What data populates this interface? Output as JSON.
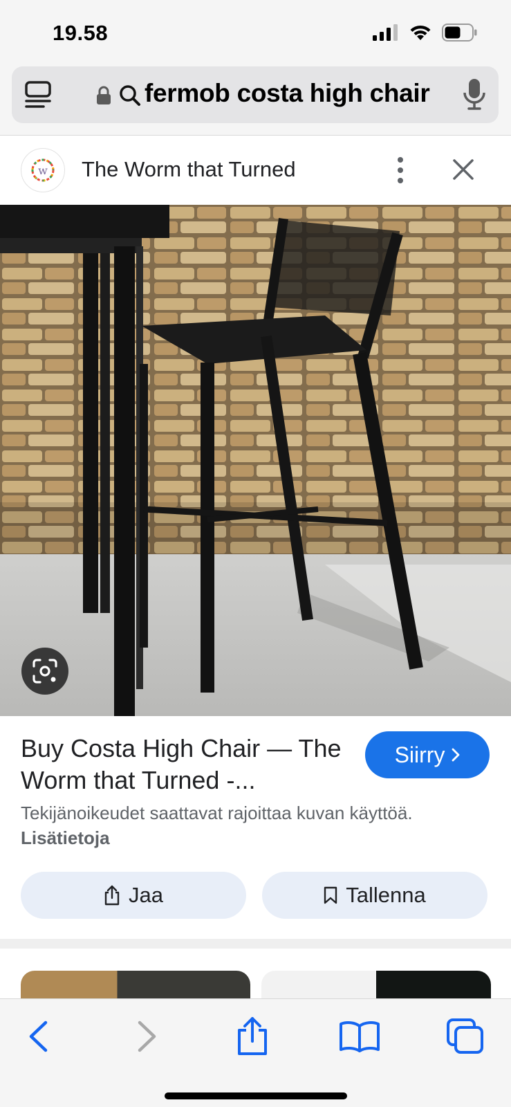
{
  "status": {
    "time": "19.58",
    "icons": [
      "signal-icon",
      "wifi-icon",
      "battery-icon"
    ]
  },
  "browser": {
    "tabs_icon": "tab-overview-icon",
    "lock_icon": "lock-icon",
    "search_icon": "search-icon",
    "url_text": "fermob costa high chair",
    "mic_icon": "microphone-icon"
  },
  "source": {
    "name": "The Worm that Turned",
    "favicon_icon": "site-favicon-icon",
    "more_icon": "more-vert-icon",
    "close_icon": "close-icon"
  },
  "image": {
    "lens_icon": "lens-icon"
  },
  "result": {
    "title": "Buy Costa High Chair — The Worm that Turned -...",
    "go_label": "Siirry",
    "go_icon": "chevron-right-icon",
    "copyright_text": "Tekijänoikeudet saattavat rajoittaa kuvan käyttöä.",
    "more_info_label": "Lisätietoja",
    "share_label": "Jaa",
    "share_icon": "share-icon",
    "save_label": "Tallenna",
    "save_icon": "bookmark-icon"
  },
  "toolbar": {
    "back_icon": "back-arrow-icon",
    "forward_icon": "forward-arrow-icon",
    "share_icon": "share-icon",
    "bookmarks_icon": "bookmarks-book-icon",
    "tabs_icon": "tabs-icon"
  },
  "colors": {
    "accent": "#1a73e8",
    "toolbar_icon": "#1565f0",
    "chip_bg": "#e8eef8"
  }
}
